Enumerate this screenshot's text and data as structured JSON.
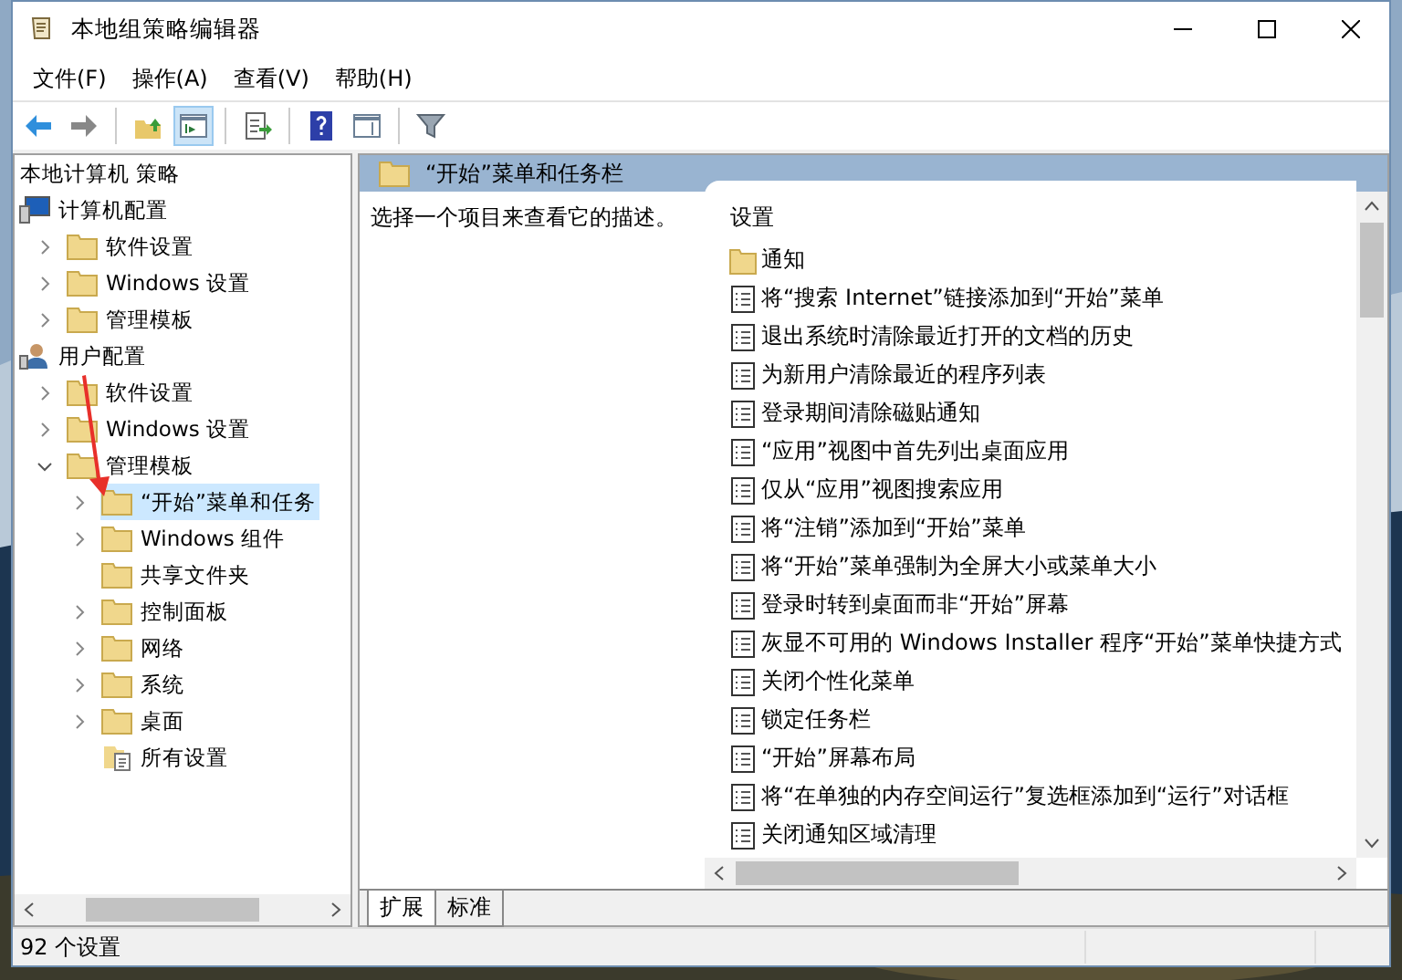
{
  "window": {
    "title": "本地组策略编辑器"
  },
  "menu": [
    "文件(F)",
    "操作(A)",
    "查看(V)",
    "帮助(H)"
  ],
  "toolbar": [
    {
      "kind": "back",
      "pressed": false
    },
    {
      "kind": "forward",
      "pressed": false
    },
    {
      "kind": "sep"
    },
    {
      "kind": "up",
      "pressed": false
    },
    {
      "kind": "tree",
      "pressed": true
    },
    {
      "kind": "sep"
    },
    {
      "kind": "export",
      "pressed": false
    },
    {
      "kind": "sep"
    },
    {
      "kind": "help",
      "pressed": false
    },
    {
      "kind": "panel",
      "pressed": false
    },
    {
      "kind": "sep"
    },
    {
      "kind": "filter",
      "pressed": false
    }
  ],
  "tree": {
    "label": "本地计算机 策略",
    "children": [
      {
        "label": "计算机配置",
        "kind": "computer",
        "selected": false,
        "children": [
          {
            "label": "软件设置",
            "kind": "folder",
            "expandable": true,
            "expanded": false,
            "selected": false
          },
          {
            "label": "Windows 设置",
            "kind": "folder",
            "expandable": true,
            "expanded": false,
            "selected": false
          },
          {
            "label": "管理模板",
            "kind": "folder",
            "expandable": true,
            "expanded": false,
            "selected": false
          }
        ]
      },
      {
        "label": "用户配置",
        "kind": "user",
        "selected": false,
        "children": [
          {
            "label": "软件设置",
            "kind": "folder",
            "expandable": true,
            "expanded": false,
            "selected": false
          },
          {
            "label": "Windows 设置",
            "kind": "folder",
            "expandable": true,
            "expanded": false,
            "selected": false
          },
          {
            "label": "管理模板",
            "kind": "folder",
            "expandable": true,
            "expanded": true,
            "selected": false,
            "children": [
              {
                "label": "“开始”菜单和任务",
                "kind": "folder",
                "expandable": true,
                "expanded": false,
                "selected": true
              },
              {
                "label": "Windows 组件",
                "kind": "folder",
                "expandable": true,
                "expanded": false,
                "selected": false
              },
              {
                "label": "共享文件夹",
                "kind": "folder",
                "expandable": false,
                "selected": false
              },
              {
                "label": "控制面板",
                "kind": "folder",
                "expandable": true,
                "expanded": false,
                "selected": false
              },
              {
                "label": "网络",
                "kind": "folder",
                "expandable": true,
                "expanded": false,
                "selected": false
              },
              {
                "label": "系统",
                "kind": "folder",
                "expandable": true,
                "expanded": false,
                "selected": false
              },
              {
                "label": "桌面",
                "kind": "folder",
                "expandable": true,
                "expanded": false,
                "selected": false
              },
              {
                "label": "所有设置",
                "kind": "allsettings",
                "expandable": false,
                "selected": false
              }
            ]
          }
        ]
      }
    ]
  },
  "details": {
    "header": "“开始”菜单和任务栏",
    "description": "选择一个项目来查看它的描述。",
    "column": "设置",
    "items": [
      {
        "label": "通知",
        "kind": "folder"
      },
      {
        "label": "将“搜索 Internet”链接添加到“开始”菜单",
        "kind": "setting"
      },
      {
        "label": "退出系统时清除最近打开的文档的历史",
        "kind": "setting"
      },
      {
        "label": "为新用户清除最近的程序列表",
        "kind": "setting"
      },
      {
        "label": "登录期间清除磁贴通知",
        "kind": "setting"
      },
      {
        "label": "“应用”视图中首先列出桌面应用",
        "kind": "setting"
      },
      {
        "label": "仅从“应用”视图搜索应用",
        "kind": "setting"
      },
      {
        "label": "将“注销”添加到“开始”菜单",
        "kind": "setting"
      },
      {
        "label": "将“开始”菜单强制为全屏大小或菜单大小",
        "kind": "setting"
      },
      {
        "label": "登录时转到桌面而非“开始”屏幕",
        "kind": "setting"
      },
      {
        "label": "灰显不可用的 Windows Installer 程序“开始”菜单快捷方式",
        "kind": "setting"
      },
      {
        "label": "关闭个性化菜单",
        "kind": "setting"
      },
      {
        "label": "锁定任务栏",
        "kind": "setting"
      },
      {
        "label": "“开始”屏幕布局",
        "kind": "setting"
      },
      {
        "label": "将“在单独的内存空间运行”复选框添加到“运行”对话框",
        "kind": "setting"
      },
      {
        "label": "关闭通知区域清理",
        "kind": "setting"
      }
    ]
  },
  "tabs": [
    {
      "label": "扩展",
      "selected": true
    },
    {
      "label": "标准",
      "selected": false
    }
  ],
  "status_bar": "92 个设置"
}
